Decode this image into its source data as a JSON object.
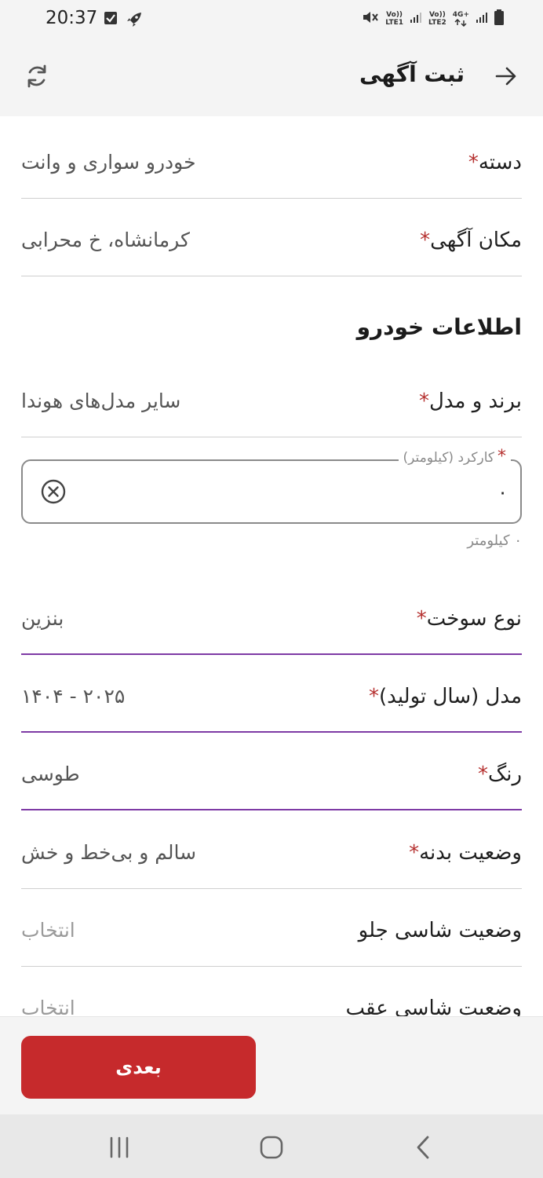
{
  "status_bar": {
    "time": "20:37",
    "sim1": "LTE1",
    "sim2": "LTE2",
    "net": "4G+",
    "volte": "Vo))"
  },
  "header": {
    "title": "ثبت آگهی"
  },
  "rows": {
    "category": {
      "label": "دسته",
      "value": "خودرو سواری و وانت"
    },
    "location": {
      "label": "مکان آگهی",
      "value": "کرمانشاه، خ محرابی"
    },
    "brand": {
      "label": "برند و مدل",
      "value": "سایر مدل‌های هوندا"
    },
    "fuel": {
      "label": "نوع سوخت",
      "value": "بنزین"
    },
    "year": {
      "label": "مدل (سال تولید)",
      "value": "۱۴۰۴ - ۲۰۲۵"
    },
    "color": {
      "label": "رنگ",
      "value": "طوسی"
    },
    "body": {
      "label": "وضعیت بدنه",
      "value": "سالم و بی‌خط و خش"
    },
    "front_chassis": {
      "label": "وضعیت شاسی جلو",
      "value": "انتخاب"
    },
    "rear_chassis": {
      "label": "وضعیت شاسی عقب",
      "value": "انتخاب"
    }
  },
  "section": {
    "title": "اطلاعات خودرو"
  },
  "mileage": {
    "label": "کارکرد (کیلومتر)",
    "value": "۰",
    "helper": "۰ کیلومتر"
  },
  "required_mark": "*",
  "actions": {
    "next_label": "بعدی"
  },
  "colors": {
    "accent": "#c62a2c",
    "focus_underline": "#7e3aa5",
    "required": "#b5302f"
  }
}
